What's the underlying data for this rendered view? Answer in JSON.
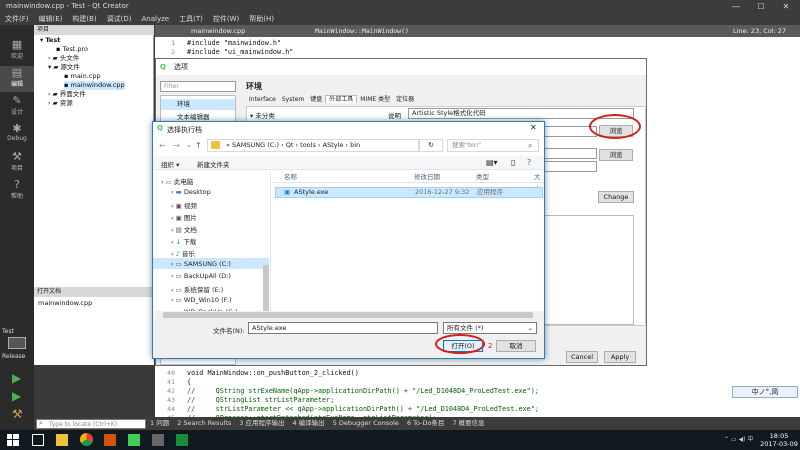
{
  "window": {
    "title": "mainwindow.cpp - Test - Qt Creator",
    "menus": [
      "文件(F)",
      "编辑(E)",
      "构建(B)",
      "调试(D)",
      "Analyze",
      "工具(T)",
      "控件(W)",
      "帮助(H)"
    ]
  },
  "modes": [
    {
      "label": "欢迎",
      "icon": "grid-icon"
    },
    {
      "label": "编辑",
      "icon": "edit-icon"
    },
    {
      "label": "设计",
      "icon": "design-icon"
    },
    {
      "label": "Debug",
      "icon": "bug-icon"
    },
    {
      "label": "项目",
      "icon": "wrench-icon"
    },
    {
      "label": "帮助",
      "icon": "help-icon"
    }
  ],
  "run_target": {
    "project": "Test",
    "config": "Release"
  },
  "project_panel": {
    "header": "项目",
    "tree": [
      "Test",
      "Test.pro",
      "头文件",
      "源文件",
      "main.cpp",
      "mainwindow.cpp",
      "界面文件",
      "资源"
    ]
  },
  "open_docs": {
    "header": "打开文档",
    "items": [
      "mainwindow.cpp"
    ]
  },
  "editor": {
    "tab": "mainwindow.cpp",
    "symbol": "MainWindow::MainWindow()",
    "position": "Line: 23, Col: 27",
    "top_lines": [
      {
        "n": "1",
        "text": "#include \"mainwindow.h\""
      },
      {
        "n": "2",
        "text": "#include \"ui_mainwindow.h\""
      }
    ],
    "bottom_lines": [
      {
        "n": "40",
        "text": "void MainWindow::on_pushButton_2_clicked()"
      },
      {
        "n": "41",
        "text": "{"
      },
      {
        "n": "42",
        "text": "//     QString strExeName(qApp->applicationDirPath() + \"/Led_D1048D4_ProLedTest.exe\");"
      },
      {
        "n": "43",
        "text": "//     QStringList strListParameter;"
      },
      {
        "n": "44",
        "text": "//     strListParameter << qApp->applicationDirPath() + \"/Led_D1048D4_ProLedTest.exe\";"
      },
      {
        "n": "45",
        "text": "//     QProcess::startDetached(strExeName, strListParameter);"
      }
    ]
  },
  "output_tabs": [
    "1 问题",
    "2 Search Results",
    "3 应用程序输出",
    "4 编译输出",
    "5 Debugger Console",
    "6 To-Do条目",
    "7 概要信息"
  ],
  "options_dialog": {
    "title": "选项",
    "filter_placeholder": "Filter",
    "categories": [
      "环境",
      "文本编辑器"
    ],
    "heading": "环境",
    "tabs": [
      "Interface",
      "System",
      "键盘",
      "外部工具",
      "MIME 类型",
      "定位器"
    ],
    "tree_item": "未分类",
    "description_label": "说明",
    "description_value": "Artistic Style格式化代码",
    "browse_label": "浏览",
    "change_label": "Change",
    "cancel_label": "Cancel",
    "apply_label": "Apply"
  },
  "file_dialog": {
    "title": "选择执行档",
    "path": [
      "SAMSUNG (C:)",
      "Qt",
      "tools",
      "AStyle",
      "bin"
    ],
    "search_placeholder": "搜索\"bin\"",
    "organize_label": "组织 ▾",
    "new_folder_label": "新建文件夹",
    "nav": [
      "此电脑",
      "Desktop",
      "视频",
      "图片",
      "文档",
      "下载",
      "音乐",
      "SAMSUNG (C:)",
      "BackUpAll (D:)",
      "系统保留 (E:)",
      "WD_Win10 (F:)",
      "WD_BackUp (G:)"
    ],
    "columns": {
      "name": "名称",
      "date": "修改日期",
      "type": "类型",
      "size": "大小"
    },
    "files": [
      {
        "name": "AStyle.exe",
        "date": "2016-12-27 9:32",
        "type": "应用程序"
      }
    ],
    "filename_label": "文件名(N):",
    "filename_value": "AStyle.exe",
    "filter_value": "所有文件 (*)",
    "open_label": "打开(O)",
    "cancel_label": "取消",
    "step_marker": "2"
  },
  "taskbar": {
    "search_placeholder": "Type to locate (Ctrl+K)",
    "time": "18:05",
    "date": "2017-03-09"
  },
  "ime": "中ノ°,简",
  "colors": {
    "highlight": "#d0201c",
    "selection": "#cce8ff",
    "accent": "#0078d7"
  }
}
